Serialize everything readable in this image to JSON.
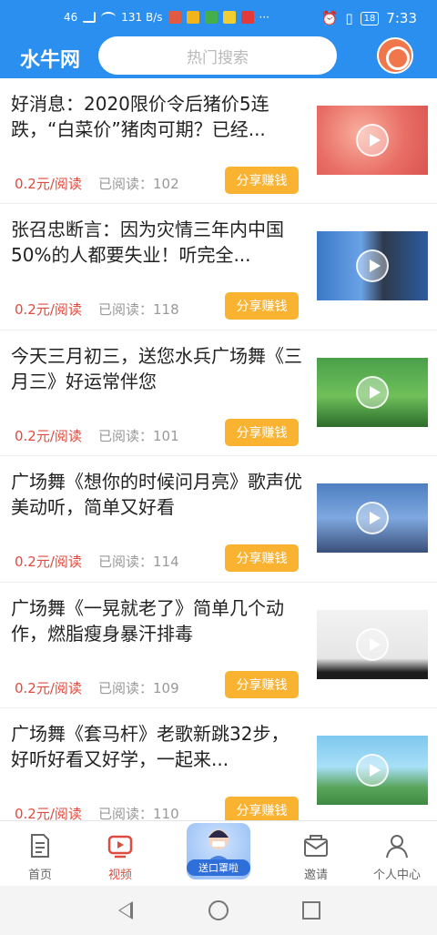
{
  "status": {
    "left": [
      "46",
      "131 B/s"
    ],
    "time": "7:33",
    "battery": "18"
  },
  "appbar": {
    "brand": "水牛网",
    "search_placeholder": "热门搜索"
  },
  "articles": [
    {
      "title": "好消息：2020限价令后猪价5连跌，“白菜价”猪肉可期？已经...",
      "price": "0.2元/阅读",
      "reads": "已阅读：102",
      "share": "分享赚钱",
      "thumb_icon": "video-play-icon"
    },
    {
      "title": "张召忠断言：因为灾情三年内中国50%的人都要失业！听完全...",
      "price": "0.2元/阅读",
      "reads": "已阅读：118",
      "share": "分享赚钱",
      "thumb_icon": "video-play-icon"
    },
    {
      "title": "今天三月初三，送您水兵广场舞《三月三》好运常伴您",
      "price": "0.2元/阅读",
      "reads": "已阅读：101",
      "share": "分享赚钱",
      "thumb_icon": "video-play-icon"
    },
    {
      "title": "广场舞《想你的时候问月亮》歌声优美动听，简单又好看",
      "price": "0.2元/阅读",
      "reads": "已阅读：114",
      "share": "分享赚钱",
      "thumb_icon": "video-play-icon"
    },
    {
      "title": "广场舞《一晃就老了》简单几个动作，燃脂瘦身暴汗排毒",
      "price": "0.2元/阅读",
      "reads": "已阅读：109",
      "share": "分享赚钱",
      "thumb_icon": "video-play-icon"
    },
    {
      "title": "广场舞《套马杆》老歌新跳32步，好听好看又好学，一起来...",
      "price": "0.2元/阅读",
      "reads": "已阅读：110",
      "share": "分享赚钱",
      "thumb_icon": "video-play-icon"
    }
  ],
  "tabs": {
    "home": "首页",
    "video": "视频",
    "promo": "送口罩啦",
    "invite": "邀请",
    "profile": "个人中心"
  },
  "colors": {
    "primary": "#2b8ff0",
    "price": "#e04b3f",
    "share_button": "#f9b331"
  }
}
